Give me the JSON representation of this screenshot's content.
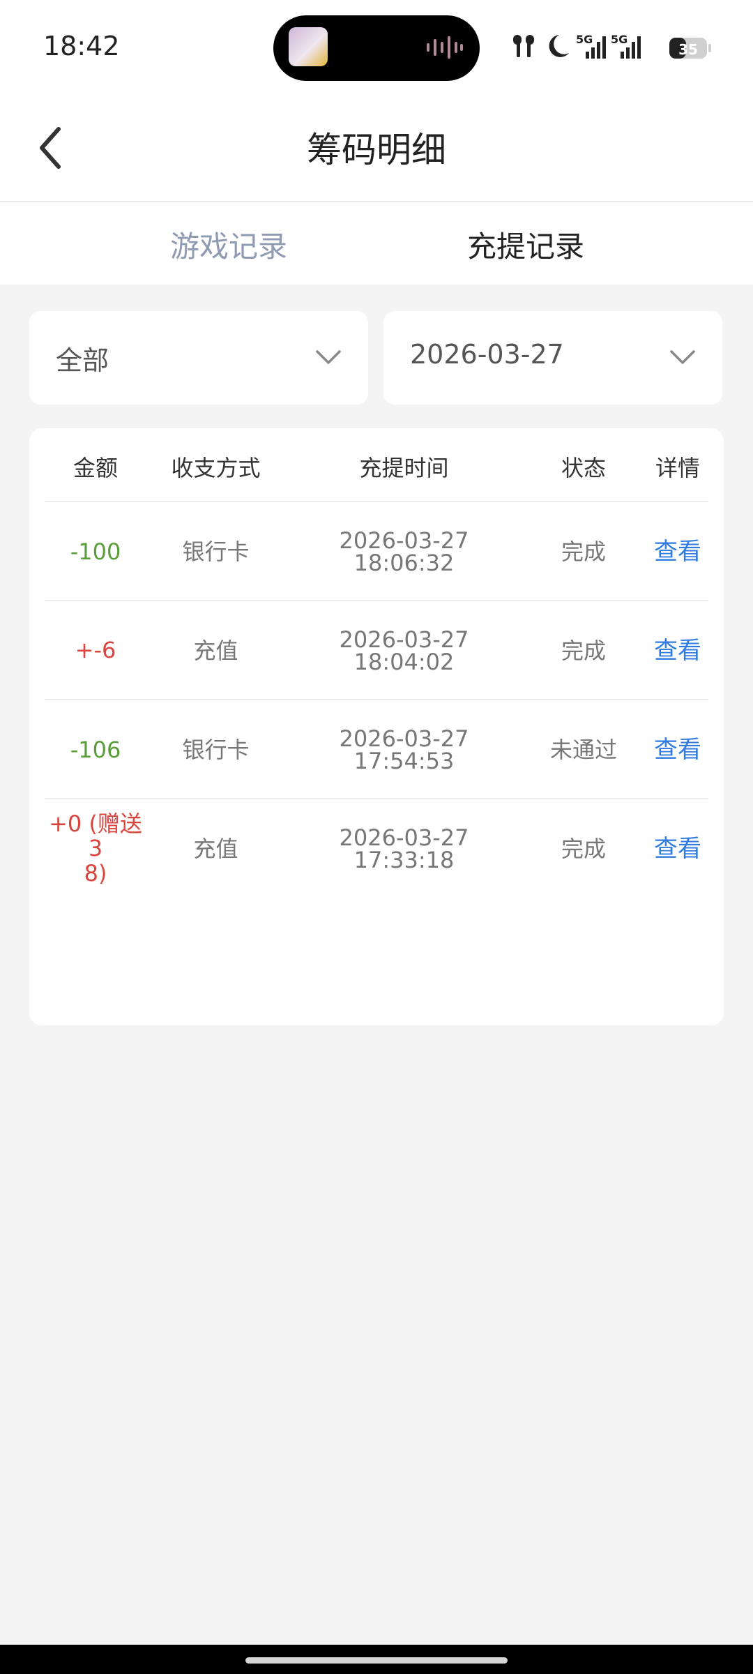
{
  "status": {
    "time": "18:42",
    "battery": "35",
    "net1": "5G",
    "net2": "5G"
  },
  "header": {
    "title": "筹码明细"
  },
  "tabs": [
    {
      "label": "游戏记录"
    },
    {
      "label": "充提记录"
    }
  ],
  "filters": {
    "type": "全部",
    "date": "2026-03-27"
  },
  "table": {
    "columns": [
      "金额",
      "收支方式",
      "充提时间",
      "状态",
      "详情"
    ],
    "rows": [
      {
        "amount": "-100",
        "method": "银行卡",
        "date": "2026-03-27",
        "time": "18:06:32",
        "status": "完成",
        "detail": "查看"
      },
      {
        "amount": "+-6",
        "method": "充值",
        "date": "2026-03-27",
        "time": "18:04:02",
        "status": "完成",
        "detail": "查看"
      },
      {
        "amount": "-106",
        "method": "银行卡",
        "date": "2026-03-27",
        "time": "17:54:53",
        "status": "未通过",
        "detail": "查看"
      },
      {
        "amount_line1": "+0 (赠送3",
        "amount_line2": "8)",
        "method": "充值",
        "date": "2026-03-27",
        "time": "17:33:18",
        "status": "完成",
        "detail": "查看"
      }
    ]
  },
  "colors": {
    "negative": "#5a9e3a",
    "positive": "#d9453d",
    "link": "#2f7be0",
    "inactive_tab": "#8f9bb3"
  }
}
